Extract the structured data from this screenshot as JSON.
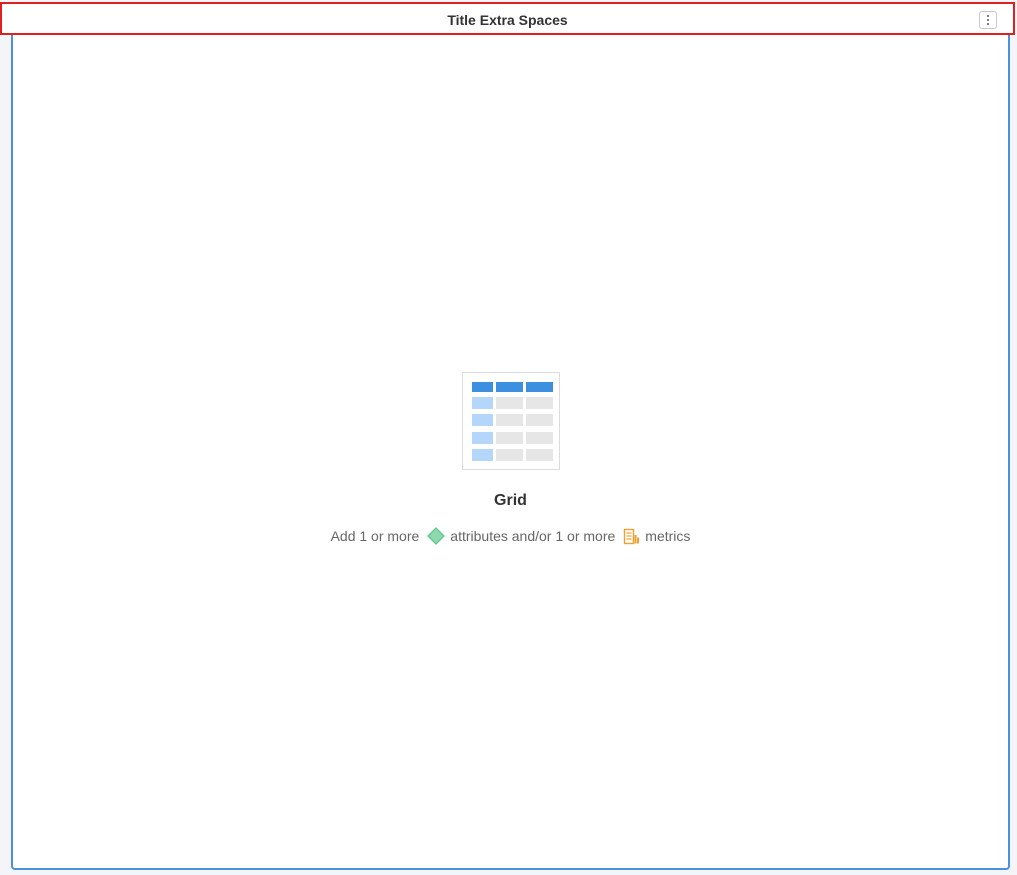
{
  "panel": {
    "title": "Title Extra Spaces",
    "more_button_icon": "vertical-ellipsis-icon"
  },
  "placeholder": {
    "visualization_icon": "grid-table-icon",
    "label": "Grid",
    "hint": {
      "part1": "Add 1 or more",
      "attribute_icon": "attribute-diamond-icon",
      "part2": "attributes and/or 1 or more",
      "metric_icon": "metric-icon",
      "part3": "metrics"
    }
  },
  "colors": {
    "panel_border": "#4a90e2",
    "title_highlight": "#e02020",
    "grid_header": "#3d8fe0",
    "grid_first_col": "#b3d6fa",
    "grid_cell": "#e6e6e6",
    "attribute_icon": "#5cc48a",
    "metric_icon": "#f0a030"
  }
}
